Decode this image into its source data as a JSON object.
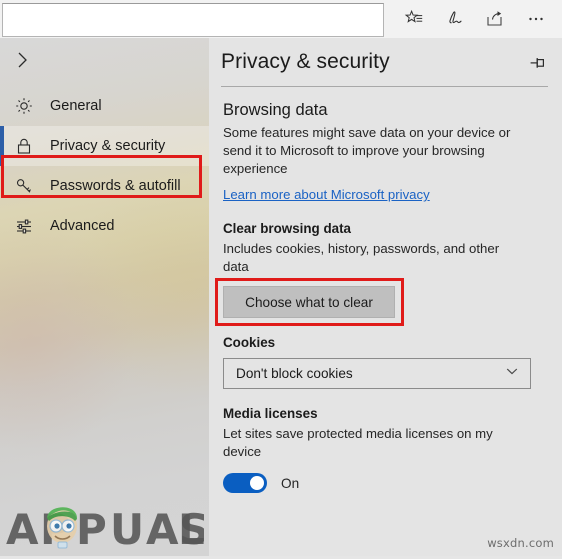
{
  "browser": {
    "address_bar": {
      "value": "",
      "placeholder": ""
    },
    "toolbar_buttons": [
      {
        "name": "favorites-reading-list-icon",
        "label": "Add to favorites or reading list"
      },
      {
        "name": "web-note-icon",
        "label": "Make a Web Note"
      },
      {
        "name": "share-icon",
        "label": "Share"
      },
      {
        "name": "more-icon",
        "label": "Settings and more"
      }
    ]
  },
  "sidebar": {
    "back_label": "Back",
    "items": [
      {
        "label": "General",
        "icon": "gear-icon",
        "selected": false
      },
      {
        "label": "Privacy & security",
        "icon": "lock-icon",
        "selected": true
      },
      {
        "label": "Passwords & autofill",
        "icon": "key-icon",
        "selected": false
      },
      {
        "label": "Advanced",
        "icon": "sliders-icon",
        "selected": false
      }
    ]
  },
  "panel": {
    "title": "Privacy & security",
    "pin_label": "Pin settings pane",
    "browsing_data": {
      "heading": "Browsing data",
      "description": "Some features might save data on your device or send it to Microsoft to improve your browsing experience",
      "link": "Learn more about Microsoft privacy"
    },
    "clear_browsing_data": {
      "heading": "Clear browsing data",
      "description": "Includes cookies, history, passwords, and other data",
      "button": "Choose what to clear"
    },
    "cookies": {
      "heading": "Cookies",
      "selected": "Don't block cookies"
    },
    "media_licenses": {
      "heading": "Media licenses",
      "description": "Let sites save protected media licenses on my device",
      "toggle_state": "On"
    }
  },
  "annotations": {
    "highlight_color": "#e01b19",
    "boxes": [
      {
        "name": "sidebar-privacy-security-highlight"
      },
      {
        "name": "choose-what-to-clear-highlight"
      }
    ]
  },
  "watermarks": {
    "brand": "APPUALS",
    "site": "wsxdn.com"
  }
}
